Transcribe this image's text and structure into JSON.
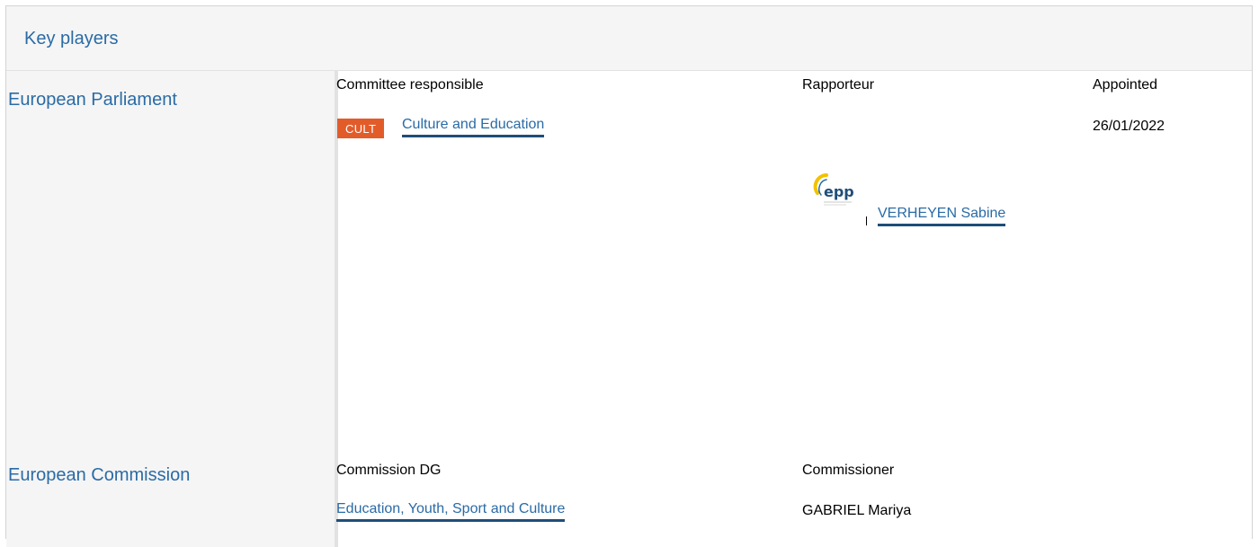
{
  "header": {
    "title": "Key players"
  },
  "parliament": {
    "label": "European Parliament",
    "committee_heading": "Committee responsible",
    "rapporteur_heading": "Rapporteur",
    "appointed_heading": "Appointed",
    "committee_badge": "CULT",
    "committee_badge_color": "#e25c2a",
    "committee_name": "Culture and Education",
    "appointed_date": "26/01/2022",
    "party_logo": {
      "icon": "epp-logo",
      "text": "epp"
    },
    "rapporteur_name": "VERHEYEN Sabine"
  },
  "commission": {
    "label": "European Commission",
    "dg_heading": "Commission DG",
    "commissioner_heading": "Commissioner",
    "dg_name": "Education, Youth, Sport and Culture",
    "commissioner_name": "GABRIEL Mariya"
  },
  "colors": {
    "accent": "#2a6ba5",
    "link_underline": "#1f4e79",
    "panel_bg": "#f5f5f5"
  }
}
